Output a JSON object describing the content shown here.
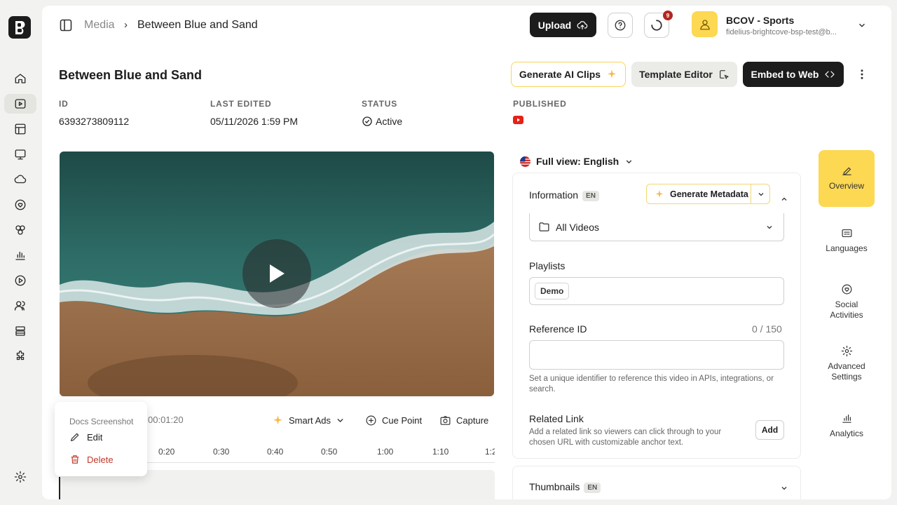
{
  "breadcrumb": {
    "parent": "Media",
    "separator": "›",
    "current": "Between Blue and Sand"
  },
  "topbar": {
    "upload_label": "Upload",
    "help_icon": "help-circle-icon",
    "notification_count": "9",
    "account_name": "BCOV - Sports",
    "account_email": "fidelius-brightcove-bsp-test@b..."
  },
  "page": {
    "title": "Between Blue and Sand",
    "actions": {
      "generate_clips": "Generate AI Clips",
      "template_editor": "Template Editor",
      "embed": "Embed to Web"
    }
  },
  "meta": {
    "id_label": "ID",
    "id_value": "6393273809112",
    "edited_label": "LAST EDITED",
    "edited_value": "05/11/2026 1:59 PM",
    "status_label": "STATUS",
    "status_value": "Active",
    "published_label": "PUBLISHED"
  },
  "player": {
    "timecode": "00:01:20",
    "smart_ads": "Smart Ads",
    "cue_point": "Cue Point",
    "capture": "Capture",
    "ticks": [
      "0:20",
      "0:30",
      "0:40",
      "0:50",
      "1:00",
      "1:10",
      "1:2"
    ]
  },
  "context_menu": {
    "title": "Docs Screenshot",
    "edit": "Edit",
    "delete": "Delete"
  },
  "language_select": "Full view: English",
  "info_panel": {
    "title": "Information",
    "lang_badge": "EN",
    "generate_metadata": "Generate Metadata",
    "folder_value": "All Videos",
    "playlists_label": "Playlists",
    "playlist_tag": "Demo",
    "reference_label": "Reference ID",
    "reference_count": "0 / 150",
    "reference_help": "Set a unique identifier to reference this video in APIs, integrations, or search.",
    "related_label": "Related Link",
    "related_help": "Add a related link so viewers can click through to your chosen URL with customizable anchor text.",
    "related_add": "Add"
  },
  "thumbnails": {
    "title": "Thumbnails",
    "lang_badge": "EN"
  },
  "side_tabs": {
    "overview": "Overview",
    "languages": "Languages",
    "social_line1": "Social",
    "social_line2": "Activities",
    "advanced_line1": "Advanced",
    "advanced_line2": "Settings",
    "analytics": "Analytics"
  },
  "colors": {
    "accent_yellow": "#fcd853",
    "dark_button": "#1c1c1c",
    "danger": "#c0392b",
    "youtube_red": "#e62117"
  }
}
